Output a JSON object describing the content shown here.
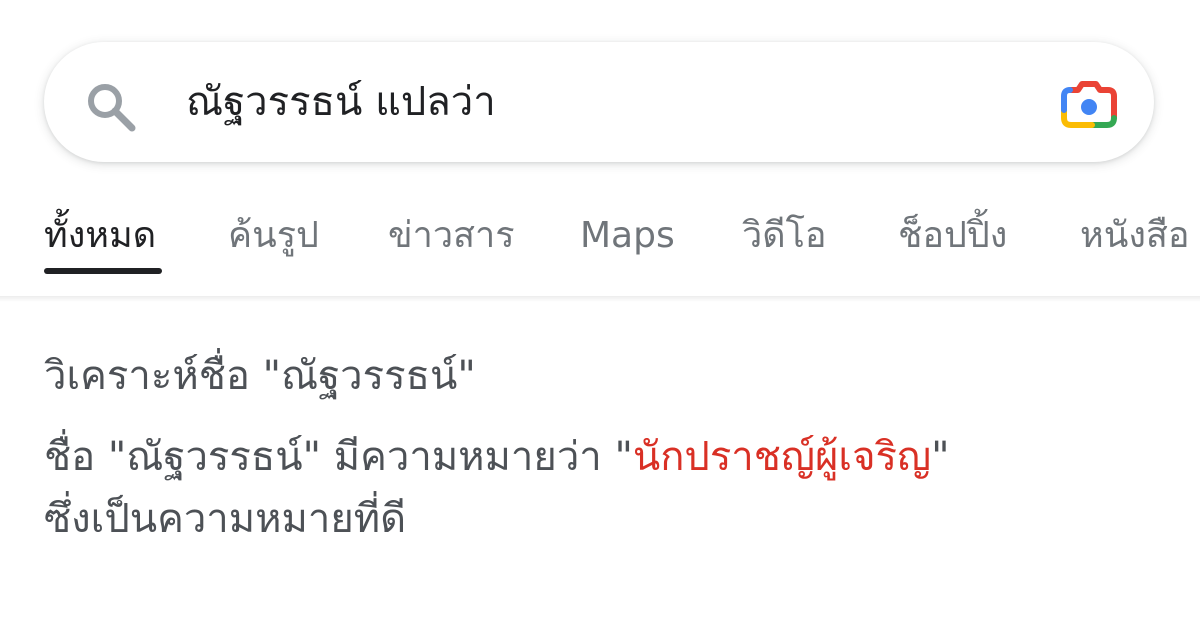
{
  "search": {
    "query": "ณัฐวรรธน์ แปลว่า"
  },
  "tabs": [
    {
      "label": "ทั้งหมด",
      "active": true
    },
    {
      "label": "ค้นรูป",
      "active": false
    },
    {
      "label": "ข่าวสาร",
      "active": false
    },
    {
      "label": "Maps",
      "active": false
    },
    {
      "label": "วิดีโอ",
      "active": false
    },
    {
      "label": "ช็อปปิ้ง",
      "active": false
    },
    {
      "label": "หนังสือ",
      "active": false
    }
  ],
  "result": {
    "title": "วิเคราะห์ชื่อ \"ณัฐวรรธน์\"",
    "line1_prefix": "ชื่อ \"ณัฐวรรธน์\" มีความหมายว่า \"",
    "line1_highlight": "นักปราชญ์ผู้เจริญ",
    "line1_suffix": "\"",
    "line2": "ซึ่งเป็นความหมายที่ดี"
  },
  "colors": {
    "highlight": "#d93025",
    "active_tab": "#202124",
    "inactive_tab": "#70757a",
    "body_text": "#4d5156"
  },
  "icons": {
    "search": "search-icon",
    "camera": "google-lens-camera-icon"
  }
}
